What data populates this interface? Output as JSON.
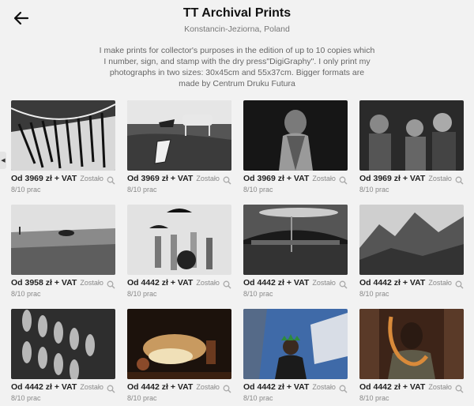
{
  "header": {
    "title": "TT Archival Prints",
    "subtitle": "Konstancin-Jeziorna, Poland",
    "description": "I make prints for collector's purposes in the edition of up to 10 copies which I number, sign, and stamp with the dry press\"DigiGraphy\". I only print my photographs in two sizes: 30x45cm and 55x37cm. Bigger formats are made by Centrum Druku Futura"
  },
  "icons": {
    "back": "arrow-left-icon",
    "zoom": "magnifier-icon",
    "side": "chevron-left-icon"
  },
  "items": [
    {
      "price": "Od 3969 zł + VAT",
      "remaining": "Zostało",
      "count": "8/10 prac"
    },
    {
      "price": "Od 3969 zł + VAT",
      "remaining": "Zostało",
      "count": "8/10 prac"
    },
    {
      "price": "Od 3969 zł + VAT",
      "remaining": "Zostało",
      "count": "8/10 prac"
    },
    {
      "price": "Od 3969 zł + VAT",
      "remaining": "Zostało",
      "count": "8/10 prac"
    },
    {
      "price": "Od 3958 zł + VAT",
      "remaining": "Zostało",
      "count": "8/10 prac"
    },
    {
      "price": "Od 4442 zł + VAT",
      "remaining": "Zostało",
      "count": "8/10 prac"
    },
    {
      "price": "Od 4442 zł + VAT",
      "remaining": "Zostało",
      "count": "8/10 prac"
    },
    {
      "price": "Od 4442 zł + VAT",
      "remaining": "Zostało",
      "count": "8/10 prac"
    },
    {
      "price": "Od 4442 zł + VAT",
      "remaining": "Zostało",
      "count": "8/10 prac"
    },
    {
      "price": "Od 4442 zł + VAT",
      "remaining": "Zostało",
      "count": "8/10 prac"
    },
    {
      "price": "Od 4442 zł + VAT",
      "remaining": "Zostało",
      "count": "8/10 prac"
    },
    {
      "price": "Od 4442 zł + VAT",
      "remaining": "Zostało",
      "count": "8/10 prac"
    }
  ]
}
